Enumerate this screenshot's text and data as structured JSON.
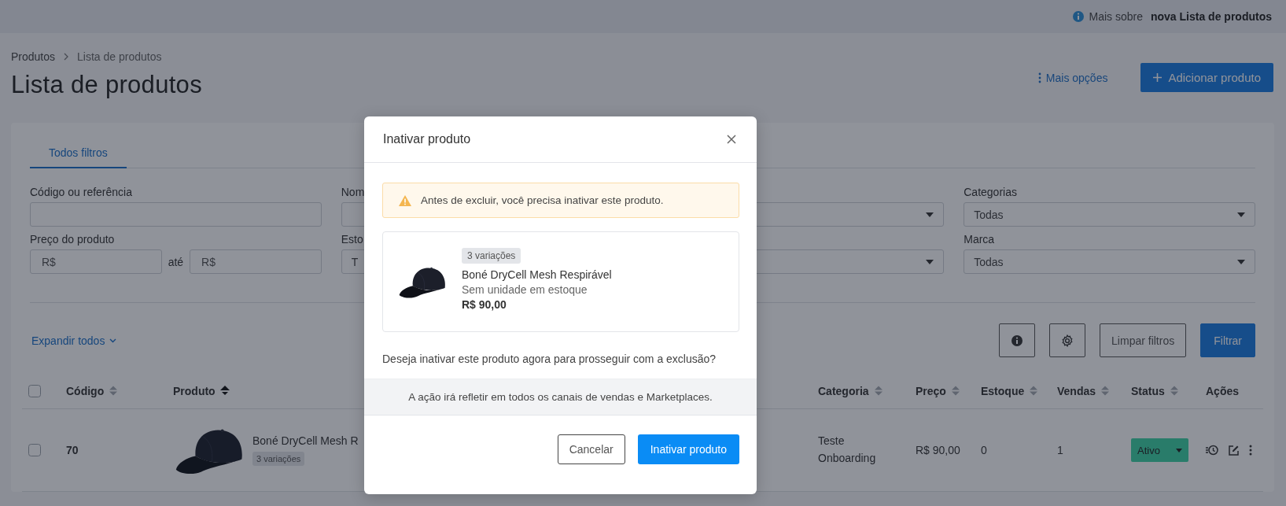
{
  "top_bar": {
    "info_prefix": "Mais sobre",
    "info_link": "nova Lista de produtos"
  },
  "breadcrumb": [
    "Produtos",
    "Lista de produtos"
  ],
  "page_title": "Lista de produtos",
  "header_actions": {
    "more": "Mais opções",
    "add": "Adicionar produto"
  },
  "filter_tabs": [
    {
      "label": "Todos filtros",
      "selected": true
    }
  ],
  "filters": [
    [
      {
        "kind": "text",
        "label": "Código ou referência"
      },
      {
        "kind": "text",
        "label": "Nom"
      },
      {
        "kind": "select"
      },
      {
        "kind": "select",
        "label": "Categorias",
        "value": "Todas"
      }
    ],
    [
      {
        "kind": "range",
        "label": "Preço do produto",
        "from_placeholder": "R$",
        "separator": "até",
        "to_placeholder": "R$"
      },
      {
        "kind": "select",
        "label": "Esto",
        "value": "T"
      },
      {
        "kind": "select"
      },
      {
        "kind": "select",
        "label": "Marca",
        "value": "Todas"
      }
    ]
  ],
  "expand_all": "Expandir todos",
  "filter_buttons": {
    "clear": "Limpar filtros",
    "apply": "Filtrar"
  },
  "table": {
    "select_all": {
      "checked": false
    },
    "columns": [
      {
        "label": "Código",
        "sorted": false
      },
      {
        "label": "Produto",
        "sorted": true
      },
      {
        "label": "Categoria",
        "sorted": false
      },
      {
        "label": "Preço",
        "sorted": false
      },
      {
        "label": "Estoque",
        "sorted": false
      },
      {
        "label": "Vendas",
        "sorted": false
      },
      {
        "label": "Status",
        "sorted": false
      },
      {
        "label": "Ações"
      }
    ],
    "rows": [
      {
        "checked": false,
        "code": "70",
        "product": "Boné DryCell Mesh R",
        "variations": "3 variações",
        "category": "Teste Onboarding",
        "price": "R$ 90,00",
        "stock": "0",
        "sales": "1",
        "status": "Ativo"
      }
    ]
  },
  "modal": {
    "title": "Inativar produto",
    "alert": "Antes de excluir, você precisa inativar este produto.",
    "product": {
      "variations": "3 variações",
      "name": "Boné DryCell Mesh Respirável",
      "stock": "Sem unidade em estoque",
      "price": "R$ 90,00"
    },
    "question": "Deseja inativar este produto agora para prosseguir com a exclusão?",
    "note": "A ação irá refletir em todos os canais de vendas e Marketplaces.",
    "buttons": {
      "cancel": "Cancelar",
      "confirm": "Inativar produto"
    }
  }
}
